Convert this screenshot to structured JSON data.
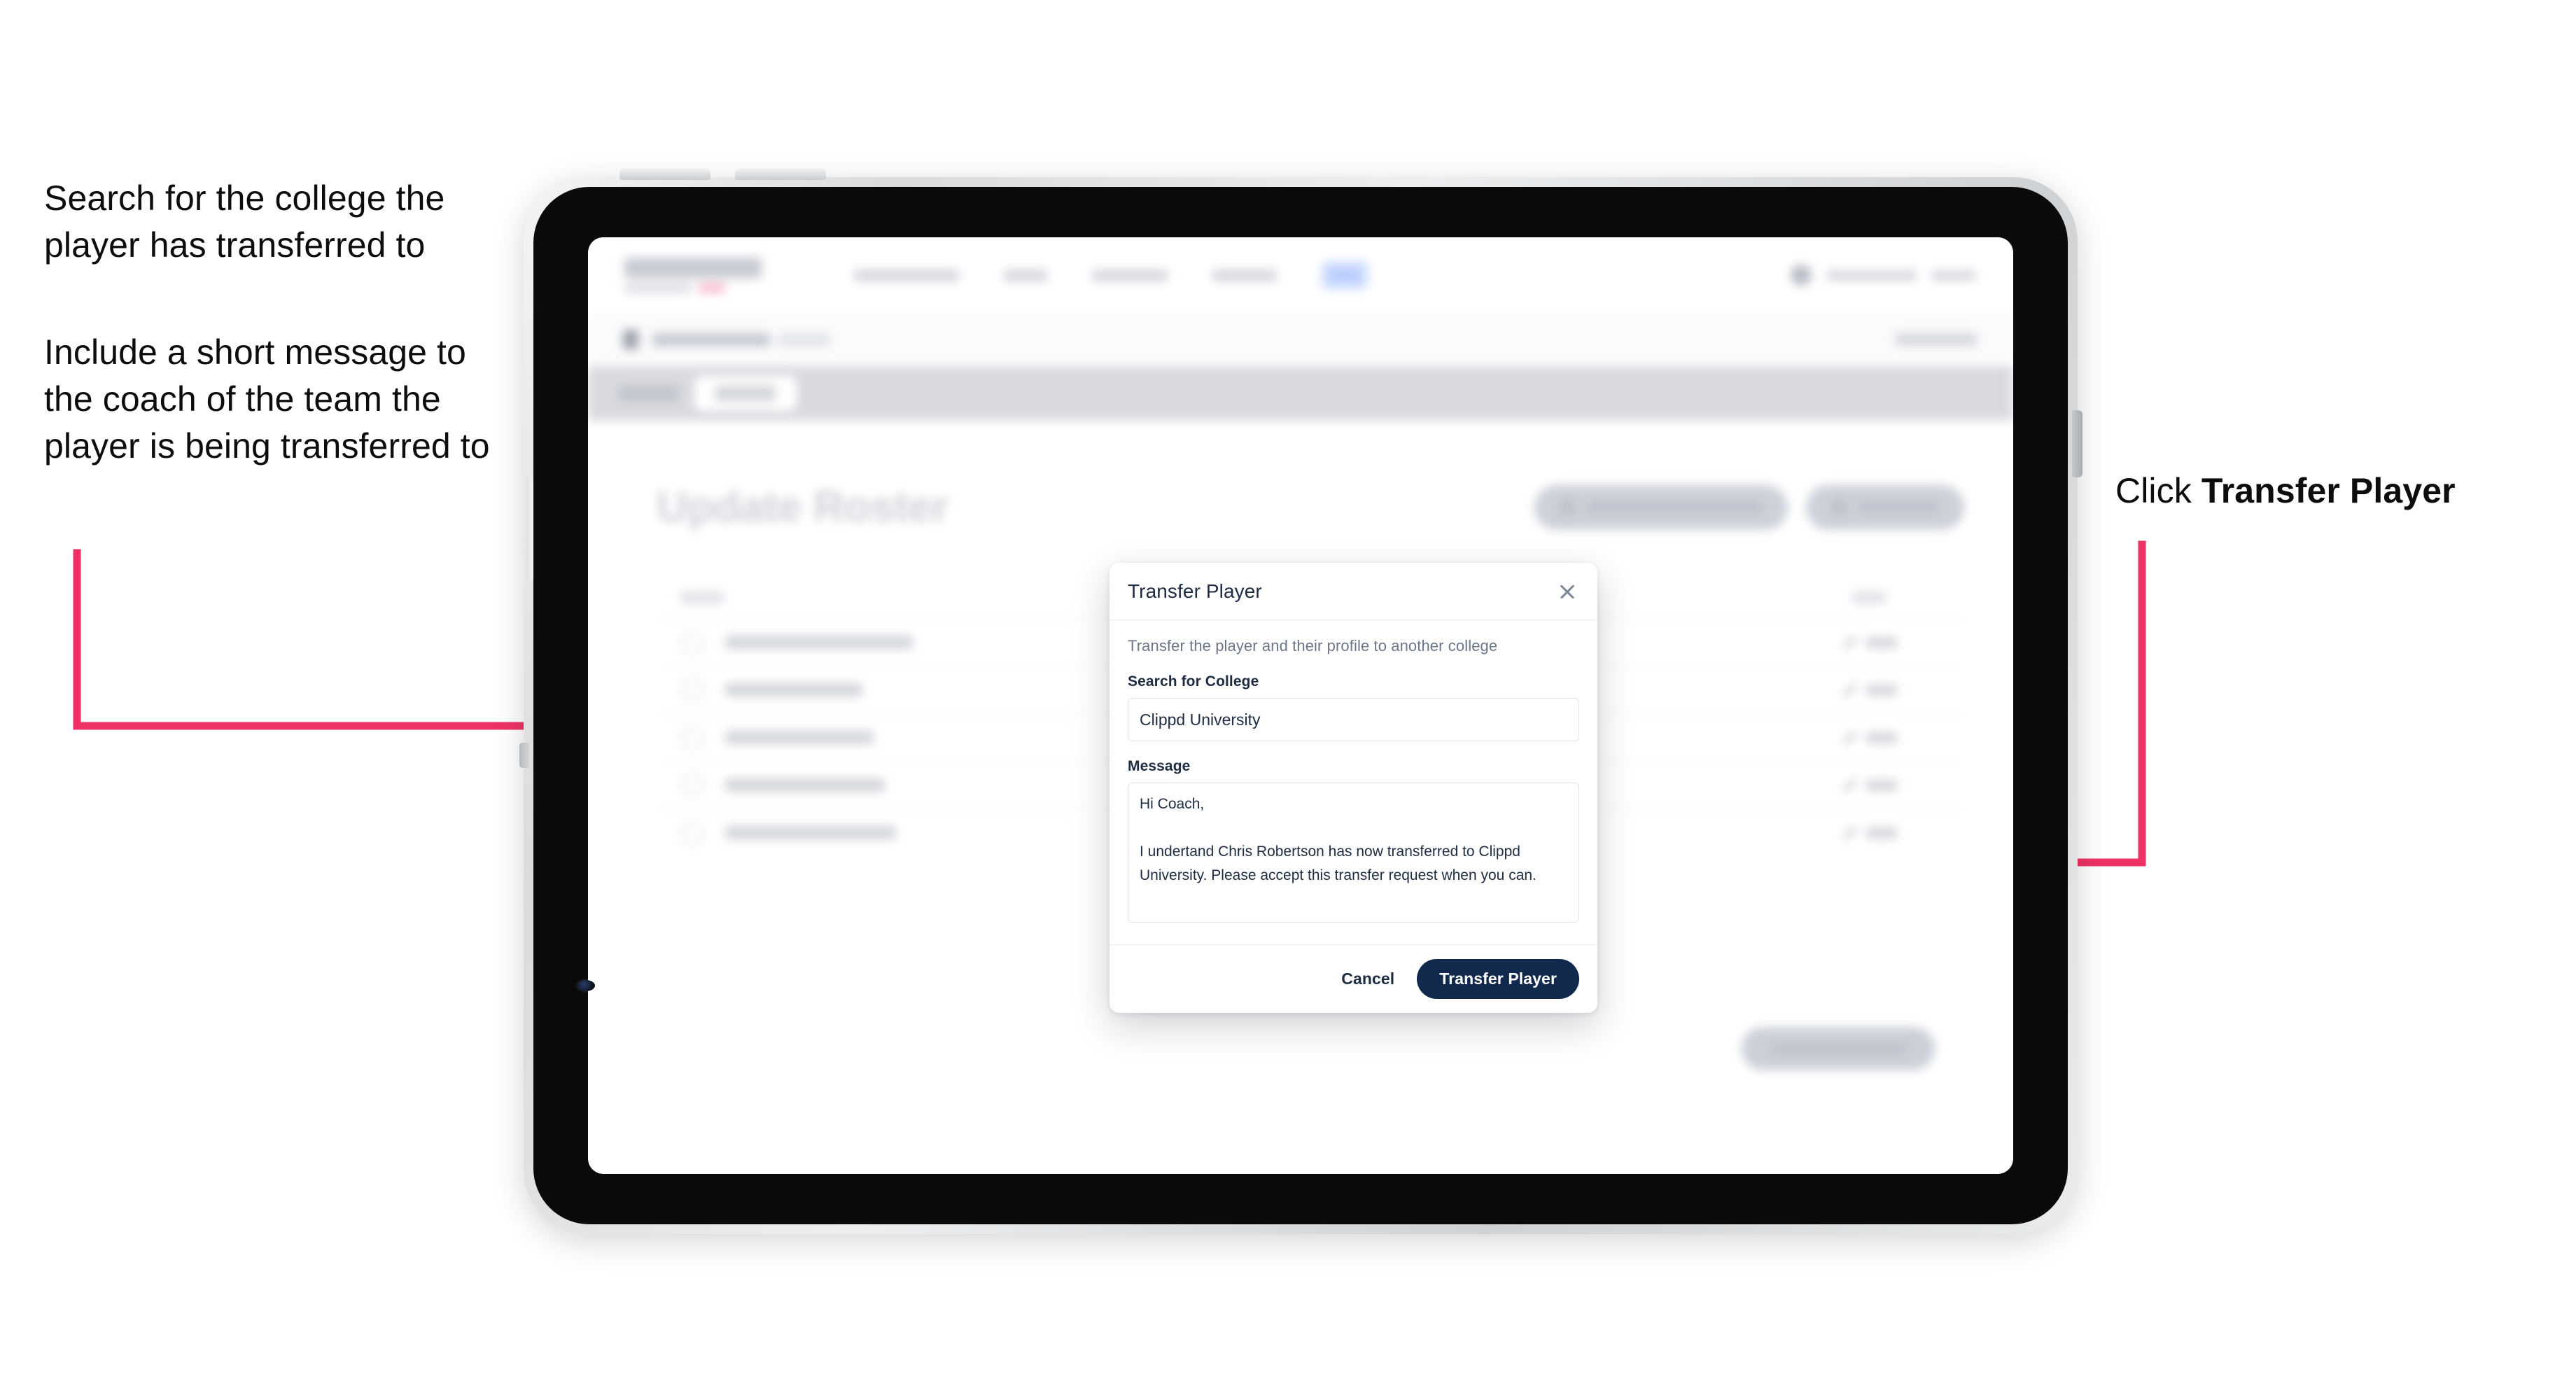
{
  "annotations": {
    "left_1": "Search for the college the player has transferred to",
    "left_2": "Include a short message to the coach of the team the player is being transferred to",
    "right_1_prefix": "Click ",
    "right_1_bold": "Transfer Player"
  },
  "colors": {
    "annotation_arrow": "#ef3265",
    "primary_button": "#11294d",
    "modal_text": "#1d2c43",
    "muted_text": "#6b7688",
    "device_bezel": "#0a0a0a",
    "nav_pill": "#cddcff"
  },
  "device": {
    "type": "tablet",
    "orientation": "landscape"
  },
  "app": {
    "page_title": "Update Roster",
    "nav": {
      "brand": "SCOREBOARD",
      "items": [
        "Tournaments",
        "Teams",
        "Schedules",
        "Analytics",
        "Roster"
      ],
      "selected": "Roster"
    },
    "subbar": {
      "title": "Scoreboard 2024",
      "right_action": "Cancel"
    },
    "tabs": [
      "Details",
      "Roster"
    ],
    "active_tab": "Roster",
    "head_actions": [
      "Request Player Transfer",
      "Add Player"
    ],
    "table": {
      "columns": [
        "Name",
        "Edit"
      ],
      "rows": [
        {
          "name": "Chris Robertson",
          "action": "Edit"
        },
        {
          "name": "Ian Whelan",
          "action": "Edit"
        },
        {
          "name": "John Taylor",
          "action": "Edit"
        },
        {
          "name": "Lewis Barton",
          "action": "Edit"
        },
        {
          "name": "Nathan Ambers",
          "action": "Edit"
        }
      ]
    },
    "bottom_cta": "Save Roster Changes"
  },
  "modal": {
    "title": "Transfer Player",
    "close_icon": "close-icon",
    "description": "Transfer the player and their profile to another college",
    "college_label": "Search for College",
    "college_value": "Clippd University",
    "college_placeholder": "Search for College",
    "message_label": "Message",
    "message_value": "Hi Coach,\n\nI undertand Chris Robertson has now transferred to Clippd University. Please accept this transfer request when you can.",
    "message_placeholder": "Message",
    "cancel_label": "Cancel",
    "submit_label": "Transfer Player"
  }
}
